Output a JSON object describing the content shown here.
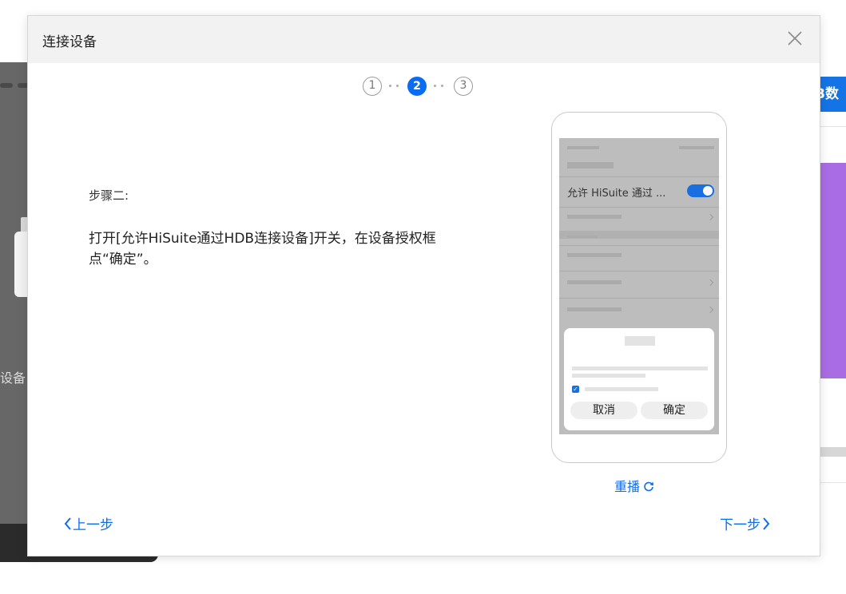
{
  "background": {
    "left_text": "设备",
    "right_button_label": "B数"
  },
  "dialog": {
    "title": "连接设备",
    "steps": [
      "1",
      "2",
      "3"
    ],
    "active_step": 2,
    "step_label": "步骤二:",
    "step_description": "打开[允许HiSuite通过HDB连接设备]开关，在设备授权框点“确定”。",
    "phone": {
      "toggle_text": "允许 HiSuite 通过 ...",
      "toggle_on": true,
      "auth_cancel": "取消",
      "auth_confirm": "确定"
    },
    "replay_label": "重播",
    "prev_label": "上一步",
    "next_label": "下一步"
  },
  "colors": {
    "accent": "#0a6cf0",
    "header_bg": "#f2f2f2",
    "bg_app": "#676767"
  }
}
